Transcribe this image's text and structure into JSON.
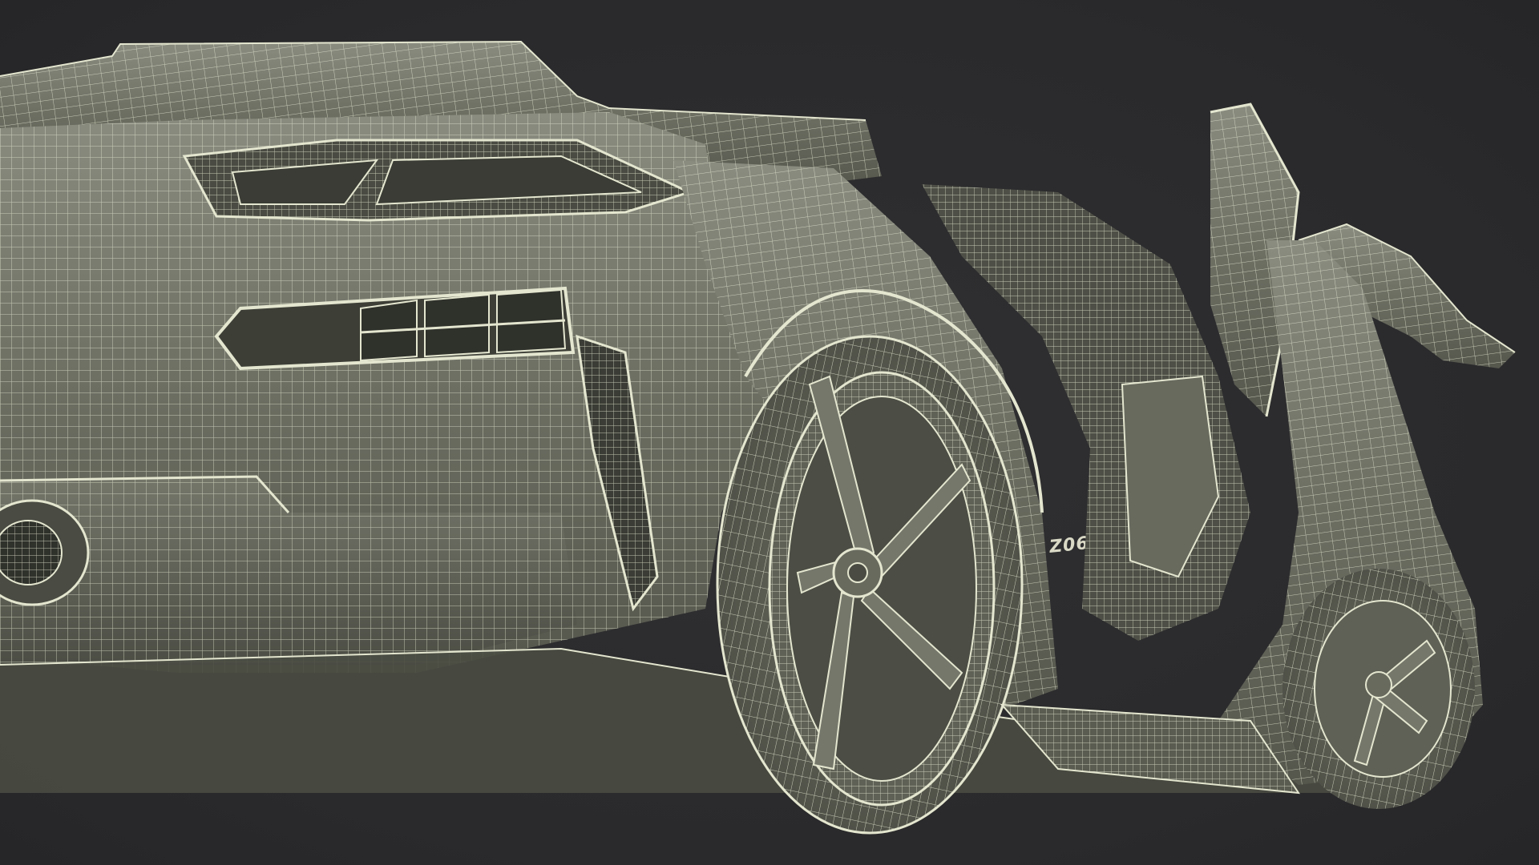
{
  "scene": {
    "background_color": "#2b2b2d",
    "body_color": "#686a5e",
    "body_shade_color": "#55574d",
    "wire_color": "#e4e6cf",
    "subject": "wireframe-sports-car-rear-three-quarter",
    "badge_text": "Z06"
  }
}
